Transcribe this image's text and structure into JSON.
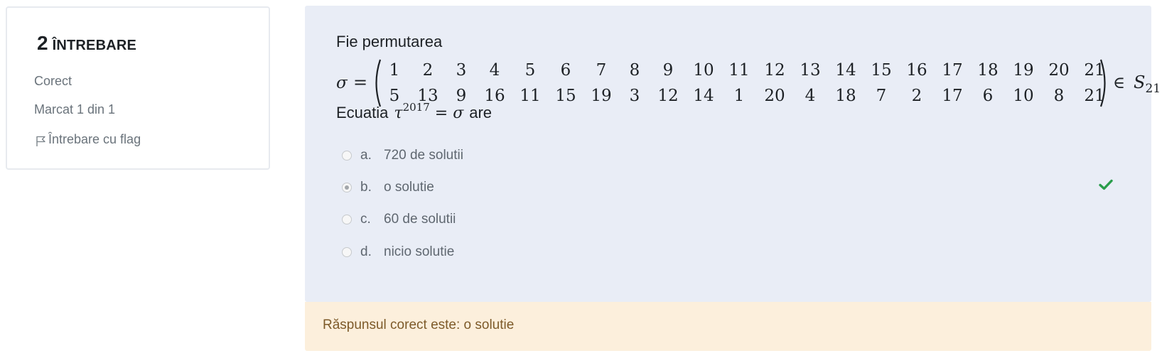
{
  "info": {
    "number": "2",
    "label": "ÎNTREBARE",
    "state": "Corect",
    "grade": "Marcat 1 din 1",
    "flag_label": "Întrebare cu flag"
  },
  "question": {
    "intro": "Fie permutarea",
    "sigma": "σ",
    "equals": "=",
    "top_row": [
      "1",
      "2",
      "3",
      "4",
      "5",
      "6",
      "7",
      "8",
      "9",
      "10",
      "11",
      "12",
      "13",
      "14",
      "15",
      "16",
      "17",
      "18",
      "19",
      "20",
      "21"
    ],
    "bottom_row": [
      "5",
      "13",
      "9",
      "16",
      "11",
      "15",
      "19",
      "3",
      "12",
      "14",
      "1",
      "20",
      "4",
      "18",
      "7",
      "2",
      "17",
      "6",
      "10",
      "8",
      "21"
    ],
    "element_of": "∈",
    "set_symbol": "S",
    "set_subscript": "21",
    "set_dot": ".",
    "eq_prefix": "Ecuatia",
    "tau": "τ",
    "exponent": "2017",
    "eq_equals": "=",
    "eq_sigma": "σ",
    "eq_suffix": "are"
  },
  "answers": [
    {
      "letter": "a.",
      "text": "720 de solutii",
      "selected": false
    },
    {
      "letter": "b.",
      "text": "o solutie",
      "selected": true
    },
    {
      "letter": "c.",
      "text": "60 de solutii",
      "selected": false
    },
    {
      "letter": "d.",
      "text": "nicio solutie",
      "selected": false
    }
  ],
  "feedback": {
    "text": "Răspunsul corect este: o solutie"
  },
  "colors": {
    "panel_bg": "#e9edf6",
    "feedback_bg": "#fcefdc",
    "feedback_text": "#7d5a29",
    "correct_check": "#2a9d4b"
  },
  "icons": {
    "flag": "flag-icon",
    "check": "check-icon"
  }
}
